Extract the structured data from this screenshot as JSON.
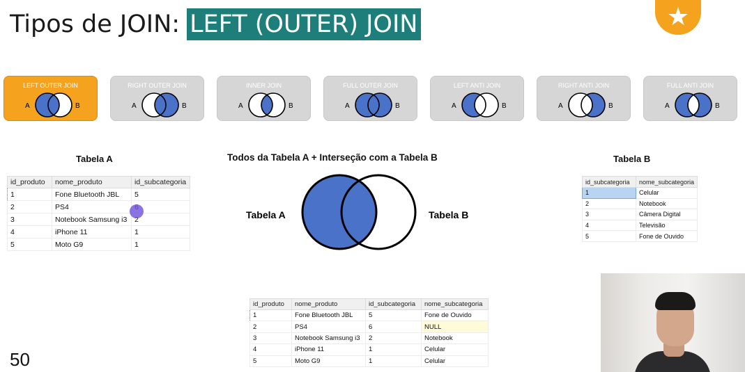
{
  "header": {
    "title_plain": "Tipos de JOIN:",
    "title_highlight": "LEFT (OUTER) JOIN",
    "star_icon": "star-icon"
  },
  "joins": [
    {
      "label": "LEFT OUTER JOIN",
      "a": "A",
      "b": "B",
      "active": true
    },
    {
      "label": "RIGHT OUTER JOIN",
      "a": "A",
      "b": "B",
      "active": false
    },
    {
      "label": "INNER JOIN",
      "a": "A",
      "b": "B",
      "active": false
    },
    {
      "label": "FULL OUTER JOIN",
      "a": "A",
      "b": "B",
      "active": false
    },
    {
      "label": "LEFT ANTI JOIN",
      "a": "A",
      "b": "B",
      "active": false
    },
    {
      "label": "RIGHT ANTI JOIN",
      "a": "A",
      "b": "B",
      "active": false
    },
    {
      "label": "FULL ANTI JOIN",
      "a": "A",
      "b": "B",
      "active": false
    }
  ],
  "table_a": {
    "caption": "Tabela A",
    "columns": [
      "id_produto",
      "nome_produto",
      "id_subcategoria"
    ],
    "rows": [
      [
        "1",
        "Fone Bluetooth JBL",
        "5"
      ],
      [
        "2",
        "PS4",
        "6"
      ],
      [
        "3",
        "Notebook Samsung i3",
        "2"
      ],
      [
        "4",
        "iPhone 11",
        "1"
      ],
      [
        "5",
        "Moto G9",
        "1"
      ]
    ]
  },
  "venn": {
    "title": "Todos da Tabela A + Interseção com a Tabela B",
    "label_a": "Tabela A",
    "label_b": "Tabela B"
  },
  "table_b": {
    "caption": "Tabela B",
    "columns": [
      "id_subcategoria",
      "nome_subcategoria"
    ],
    "rows": [
      [
        "1",
        "Celular"
      ],
      [
        "2",
        "Notebook"
      ],
      [
        "3",
        "Câmera Digital"
      ],
      [
        "4",
        "Televisão"
      ],
      [
        "5",
        "Fone de Ouvido"
      ]
    ]
  },
  "result": {
    "columns": [
      "id_produto",
      "nome_produto",
      "id_subcategoria",
      "nome_subcategoria"
    ],
    "rows": [
      [
        "1",
        "Fone Bluetooth JBL",
        "5",
        "Fone de Ouvido"
      ],
      [
        "2",
        "PS4",
        "6",
        "NULL"
      ],
      [
        "3",
        "Notebook Samsung i3",
        "2",
        "Notebook"
      ],
      [
        "4",
        "iPhone 11",
        "1",
        "Celular"
      ],
      [
        "5",
        "Moto G9",
        "1",
        "Celular"
      ]
    ]
  },
  "page_number": "50",
  "colors": {
    "accent": "#f5a21e",
    "teal": "#1e7e7a",
    "venn_fill": "#4a72c8"
  }
}
